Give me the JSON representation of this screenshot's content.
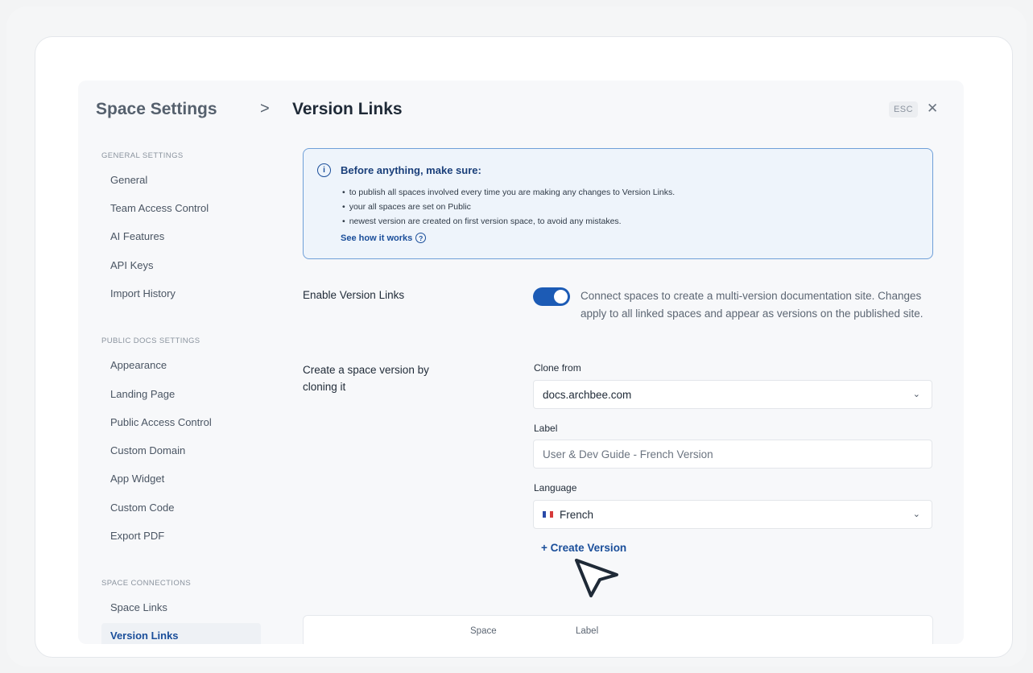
{
  "header": {
    "title": "Space Settings",
    "separator": ">",
    "page": "Version Links",
    "esc_label": "ESC",
    "close_glyph": "✕"
  },
  "sidebar": {
    "general_heading": "GENERAL SETTINGS",
    "general_items": [
      "General",
      "Team Access Control",
      "AI Features",
      "API Keys",
      "Import History"
    ],
    "public_heading": "PUBLIC DOCS SETTINGS",
    "public_items": [
      "Appearance",
      "Landing Page",
      "Public Access Control",
      "Custom Domain",
      "App Widget",
      "Custom Code",
      "Export PDF"
    ],
    "connections_heading": "SPACE CONNECTIONS",
    "connections_items": [
      "Space Links",
      "Version Links"
    ]
  },
  "info": {
    "icon": "i",
    "title": "Before anything, make sure:",
    "items": [
      "to publish all spaces involved every time you are making any changes to Version Links.",
      "your all spaces are set on Public",
      "newest version are created on first version space, to avoid any mistakes."
    ],
    "link": "See how it works",
    "help_glyph": "?"
  },
  "enable": {
    "label": "Enable Version Links",
    "enabled": true,
    "description": "Connect spaces to create a multi-version documentation site. Changes apply to all linked spaces and appear as versions on the published site."
  },
  "create": {
    "label": "Create a space version by cloning it",
    "clone_from_label": "Clone from",
    "clone_from_value": "docs.archbee.com",
    "label_label": "Label",
    "label_value": "User & Dev Guide - French Version",
    "language_label": "Language",
    "language_value": "French",
    "chevron_glyph": "⌄",
    "create_button": "+ Create Version"
  },
  "table": {
    "columns": [
      "Space",
      "Label"
    ]
  },
  "colors": {
    "accent": "#1c5bb5",
    "link": "#1a4e9a",
    "info_border": "#6f9fd8",
    "info_bg": "#eef4fb"
  }
}
